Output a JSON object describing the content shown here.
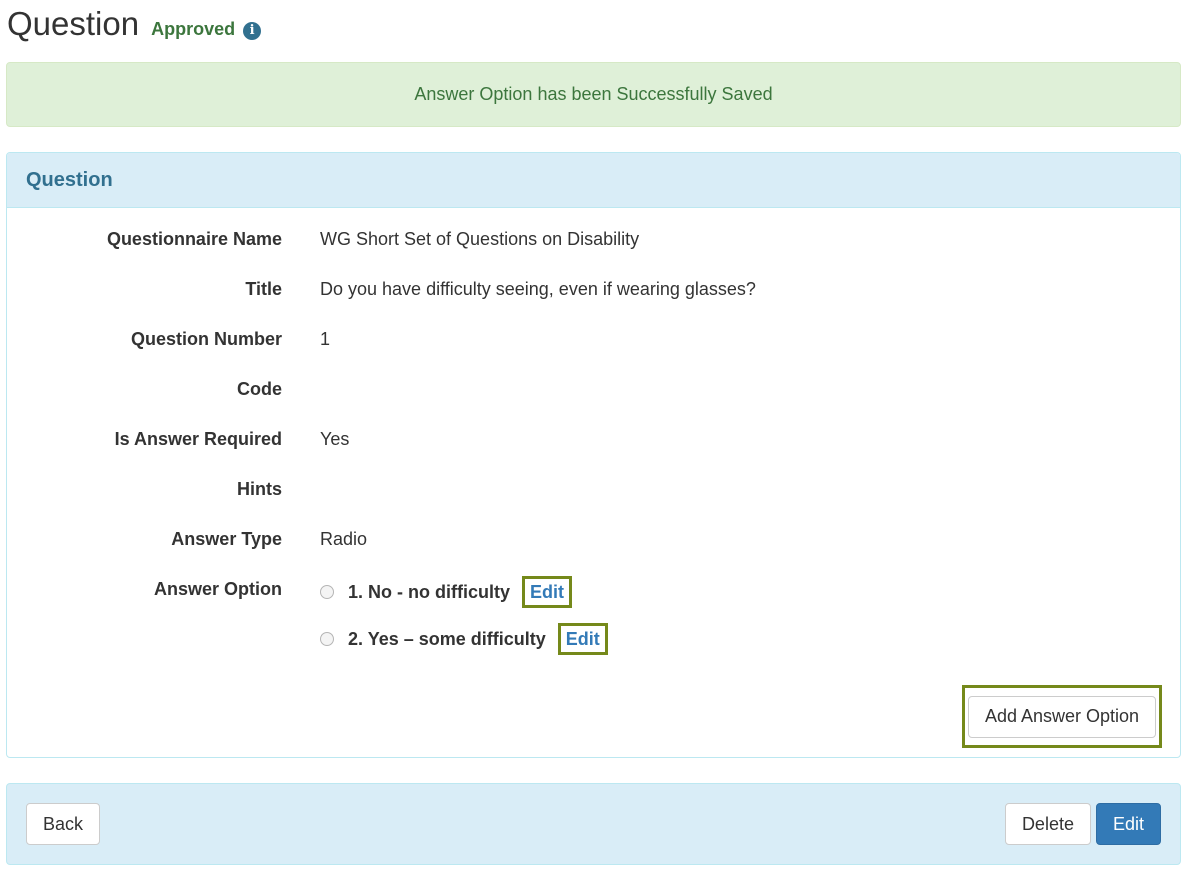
{
  "header": {
    "title": "Question",
    "status": "Approved",
    "info_icon": "i"
  },
  "alert": {
    "message": "Answer Option has been Successfully Saved"
  },
  "panel": {
    "heading": "Question",
    "fields": [
      {
        "label": "Questionnaire Name",
        "value": "WG Short Set of Questions on Disability"
      },
      {
        "label": "Title",
        "value": "Do you have difficulty seeing, even if wearing glasses?"
      },
      {
        "label": "Question Number",
        "value": "1"
      },
      {
        "label": "Code",
        "value": ""
      },
      {
        "label": "Is Answer Required",
        "value": "Yes"
      },
      {
        "label": "Hints",
        "value": ""
      },
      {
        "label": "Answer Type",
        "value": "Radio"
      }
    ],
    "answer_option_label": "Answer Option",
    "options": [
      {
        "text": "1. No - no difficulty",
        "edit_label": "Edit"
      },
      {
        "text": "2. Yes – some difficulty",
        "edit_label": "Edit"
      }
    ],
    "add_button_label": "Add Answer Option"
  },
  "footer": {
    "back_label": "Back",
    "delete_label": "Delete",
    "edit_label": "Edit"
  },
  "colors": {
    "success_text": "#3c763d",
    "info_text": "#31708f",
    "primary": "#337ab7",
    "highlight_border": "#75891a"
  }
}
